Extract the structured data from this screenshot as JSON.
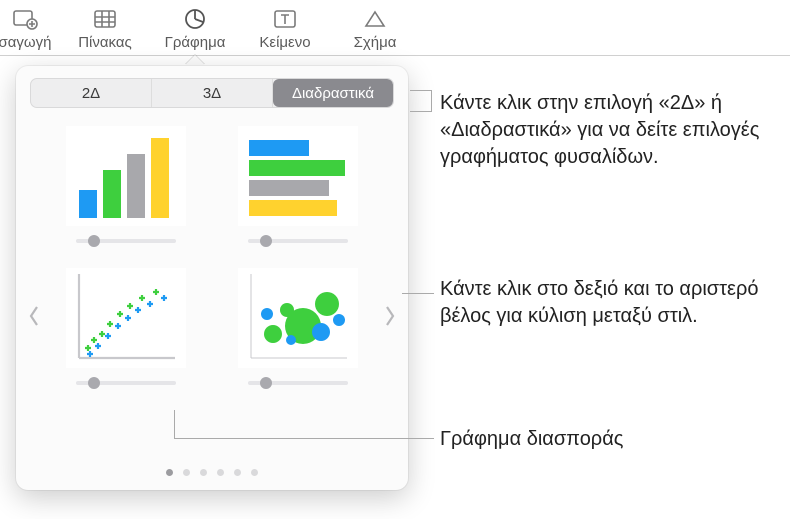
{
  "toolbar": {
    "items": [
      {
        "label": "σαγωγή",
        "icon": "insert"
      },
      {
        "label": "Πίνακας",
        "icon": "table"
      },
      {
        "label": "Γράφημα",
        "icon": "chart",
        "active": true
      },
      {
        "label": "Κείμενο",
        "icon": "text"
      },
      {
        "label": "Σχήμα",
        "icon": "shape"
      }
    ]
  },
  "popover": {
    "segments": [
      {
        "label": "2Δ"
      },
      {
        "label": "3Δ"
      },
      {
        "label": "Διαδραστικά",
        "selected": true
      }
    ],
    "charts": [
      {
        "name": "bar-vertical"
      },
      {
        "name": "bar-horizontal"
      },
      {
        "name": "scatter"
      },
      {
        "name": "bubble"
      }
    ],
    "page_dots": 6,
    "active_dot": 0
  },
  "callouts": {
    "c1": "Κάντε κλικ στην επιλογή «2Δ» ή «Διαδραστικά» για να δείτε επιλογές γραφήματος φυσαλίδων.",
    "c2": "Κάντε κλικ στο δεξιό και το αριστερό βέλος για κύλιση μεταξύ στιλ.",
    "c3": "Γράφημα διασποράς"
  }
}
